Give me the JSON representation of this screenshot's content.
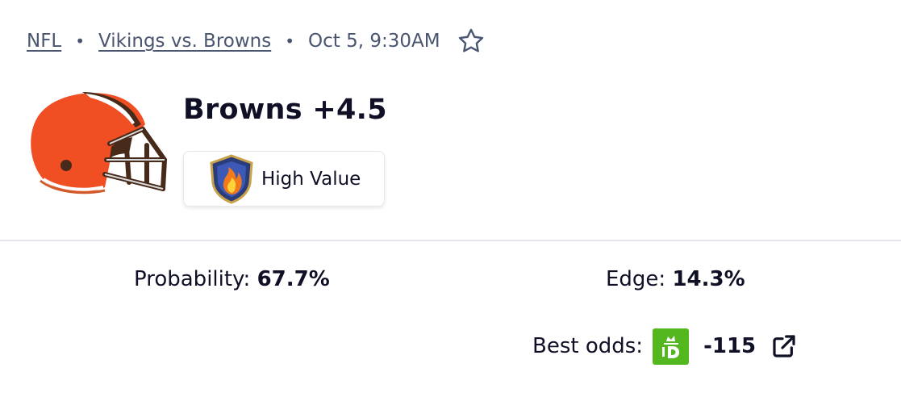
{
  "breadcrumb": {
    "league": "NFL",
    "matchup": "Vikings vs. Browns",
    "datetime": "Oct 5, 9:30AM"
  },
  "pick": {
    "title": "Browns +4.5",
    "badge_label": "High Value",
    "team_icon": "browns-helmet-icon",
    "badge_icon": "flame-shield-icon"
  },
  "stats": {
    "probability_label": "Probability:",
    "probability_value": "67.7%",
    "edge_label": "Edge:",
    "edge_value": "14.3%",
    "best_odds_label": "Best odds:",
    "best_odds_value": "-115",
    "sportsbook_icon": "draftkings-logo"
  },
  "colors": {
    "text_dark": "#0f1026",
    "muted": "#4a5570",
    "helmet_orange": "#f04e23",
    "helmet_brown": "#472a1a",
    "book_green": "#53b81f",
    "divider": "#e3e5ea"
  }
}
